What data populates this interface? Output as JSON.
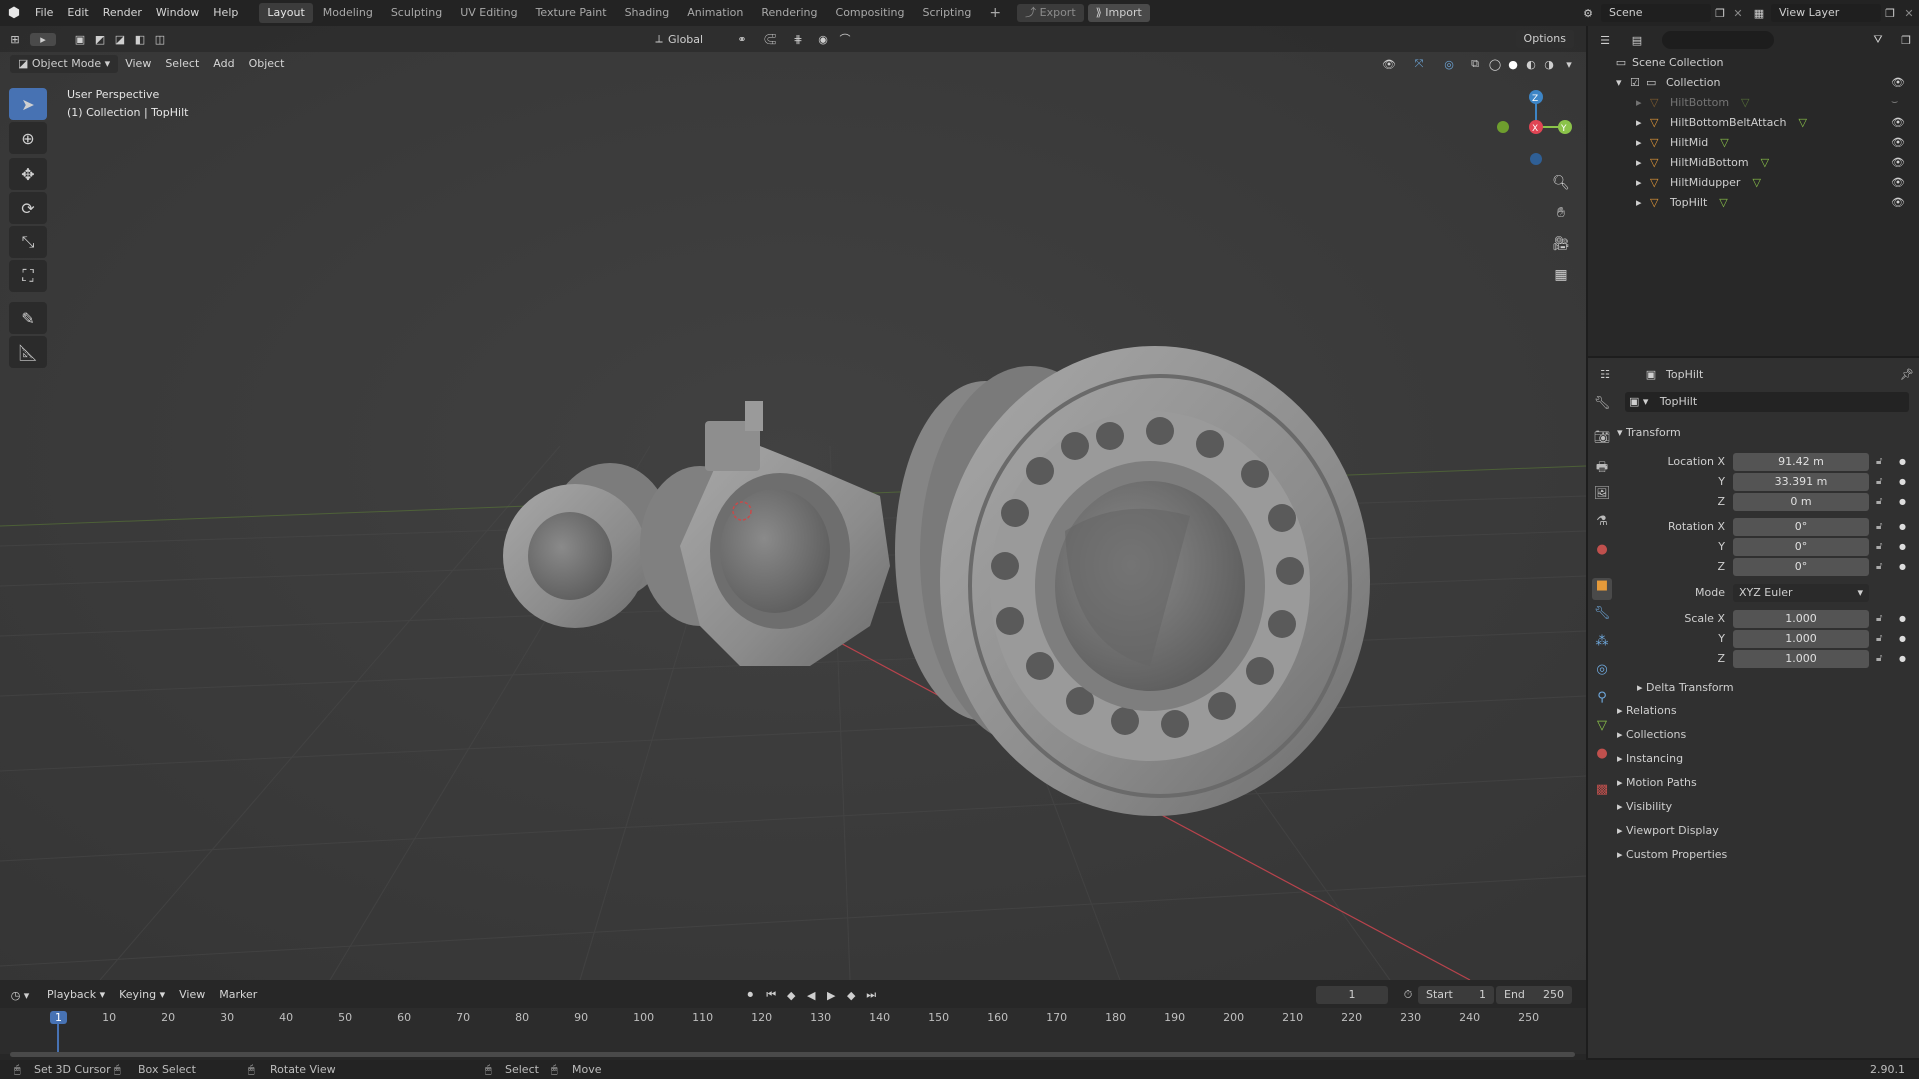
{
  "topbar": {
    "menus": [
      "File",
      "Edit",
      "Render",
      "Window",
      "Help"
    ],
    "workspaces": [
      "Layout",
      "Modeling",
      "Sculpting",
      "UV Editing",
      "Texture Paint",
      "Shading",
      "Animation",
      "Rendering",
      "Compositing",
      "Scripting"
    ],
    "active_workspace": "Layout",
    "add_tab": "+",
    "export_label": "Export",
    "import_label": "Import",
    "scene_name": "Scene",
    "view_layer_name": "View Layer"
  },
  "viewport": {
    "mode": "Object Mode",
    "menus": [
      "View",
      "Select",
      "Add",
      "Object"
    ],
    "orientation": "Global",
    "options_label": "Options",
    "perspective": "User Perspective",
    "context": "(1) Collection | TopHilt",
    "gizmo_axes": [
      "Z",
      "Y",
      "X"
    ]
  },
  "outliner": {
    "search_placeholder": "",
    "scene_collection": "Scene Collection",
    "collection": "Collection",
    "objects": [
      {
        "name": "HiltBottom",
        "hidden": true
      },
      {
        "name": "HiltBottomBeltAttach",
        "hidden": false
      },
      {
        "name": "HiltMid",
        "hidden": false
      },
      {
        "name": "HiltMidBottom",
        "hidden": false
      },
      {
        "name": "HiltMidupper",
        "hidden": false
      },
      {
        "name": "TopHilt",
        "hidden": false
      }
    ]
  },
  "properties": {
    "header_object": "TopHilt",
    "object_name": "TopHilt",
    "transform_title": "Transform",
    "location_label": "Location X",
    "location": [
      "91.42 m",
      "33.391 m",
      "0 m"
    ],
    "rotation_label": "Rotation X",
    "rotation": [
      "0°",
      "0°",
      "0°"
    ],
    "mode_label": "Mode",
    "mode_value": "XYZ Euler",
    "scale_label": "Scale X",
    "scale": [
      "1.000",
      "1.000",
      "1.000"
    ],
    "axis_y": "Y",
    "axis_z": "Z",
    "delta_transform": "Delta Transform",
    "panels": [
      "Relations",
      "Collections",
      "Instancing",
      "Motion Paths",
      "Visibility",
      "Viewport Display",
      "Custom Properties"
    ]
  },
  "timeline": {
    "menus": [
      "Playback",
      "Keying",
      "View",
      "Marker"
    ],
    "current_frame": "1",
    "start_label": "Start",
    "start": "1",
    "end_label": "End",
    "end": "250",
    "ticks": [
      "1",
      "10",
      "20",
      "30",
      "40",
      "50",
      "60",
      "70",
      "80",
      "90",
      "100",
      "110",
      "120",
      "130",
      "140",
      "150",
      "160",
      "170",
      "180",
      "190",
      "200",
      "210",
      "220",
      "230",
      "240",
      "250"
    ]
  },
  "statusbar": {
    "items": [
      "Set 3D Cursor",
      "Box Select",
      "Rotate View",
      "Select",
      "Move"
    ],
    "version": "2.90.1"
  },
  "colors": {
    "accent": "#4772b3",
    "axis_x": "#e04554",
    "axis_y": "#8bc34a",
    "axis_z": "#3d85c6",
    "object_orange": "#e59a3a"
  }
}
